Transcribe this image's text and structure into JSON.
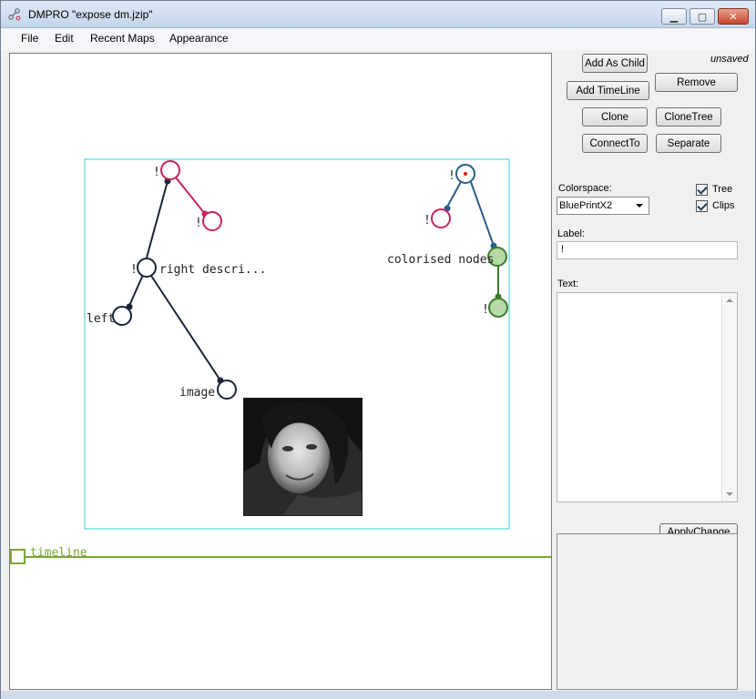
{
  "window": {
    "title": "DMPRO \"expose dm.jzip\""
  },
  "menu": [
    "File",
    "Edit",
    "Recent Maps",
    "Appearance"
  ],
  "status": {
    "unsaved": "unsaved"
  },
  "buttons": {
    "add_as_child": "Add As Child",
    "add_timeline": "Add TimeLine",
    "remove": "Remove",
    "clone": "Clone",
    "clone_tree": "CloneTree",
    "connect_to": "ConnectTo",
    "separate": "Separate",
    "apply_changes": "ApplyChange"
  },
  "properties": {
    "colorspace_label": "Colorspace:",
    "colorspace_value": "BluePrintX2",
    "tree_label": "Tree",
    "tree_checked": true,
    "clips_label": "Clips",
    "clips_checked": true,
    "label_label": "Label:",
    "label_value": "!",
    "text_label": "Text:",
    "text_value": ""
  },
  "map": {
    "frame_color": "#33d6d6",
    "nodes": {
      "n_top": "!",
      "n_top_child": "!",
      "n_right": "right descri...",
      "n_right_prefix": "!",
      "n_left": "left",
      "n_image": "image",
      "n_blue_root": "!",
      "n_blue_child": "!",
      "n_colorised": "colorised nodes",
      "n_green_child": "!"
    },
    "timeline_label": "timeline",
    "colors": {
      "dark": "#1a2338",
      "crimson": "#c8245a",
      "blue": "#2b5c8a",
      "green": "#3d7a2a",
      "green_fill": "#b6d9a6",
      "timeline": "#7aa83a"
    }
  }
}
